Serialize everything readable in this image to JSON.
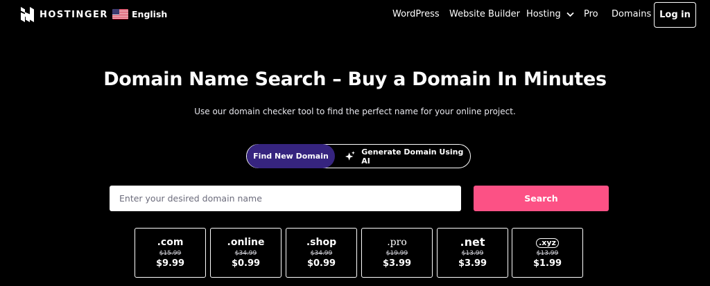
{
  "header": {
    "logo_text": "HOSTINGER",
    "language": "English",
    "nav": [
      {
        "label": "WordPress"
      },
      {
        "label": "Website Builder"
      },
      {
        "label": "Hosting"
      },
      {
        "label": "Pro"
      },
      {
        "label": "Domains"
      }
    ],
    "login_label": "Log in"
  },
  "hero": {
    "title": "Domain Name Search – Buy a Domain In Minutes",
    "subtitle": "Use our domain checker tool to find the perfect name for your online project."
  },
  "modes": {
    "active": "Find New Domain",
    "ai": "Generate Domain Using AI"
  },
  "search": {
    "placeholder": "Enter your desired domain name",
    "button": "Search"
  },
  "tlds": [
    {
      "name": ".com",
      "old_price": "$15.99",
      "price": "$9.99"
    },
    {
      "name": ".online",
      "old_price": "$34.99",
      "price": "$0.99"
    },
    {
      "name": ".shop",
      "old_price": "$34.99",
      "price": "$0.99"
    },
    {
      "name": ".pro",
      "old_price": "$19.99",
      "price": "$3.99"
    },
    {
      "name": ".net",
      "old_price": "$13.99",
      "price": "$3.99"
    },
    {
      "name": ".xyz",
      "old_price": "$13.99",
      "price": "$1.99"
    }
  ],
  "colors": {
    "background": "#000000",
    "accent_purple": "#36247f",
    "search_button": "#fc5185"
  },
  "icons": {
    "logo": "hostinger-logo-icon",
    "flag": "us-flag-icon",
    "hosting_dropdown": "chevron-down-icon",
    "ai": "sparkle-icon"
  }
}
